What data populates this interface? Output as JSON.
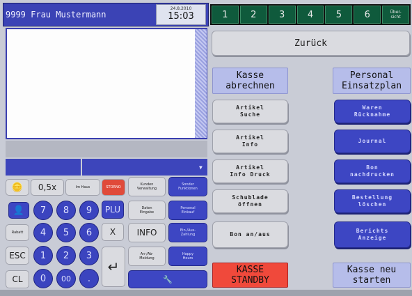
{
  "header": {
    "user": "9999 Frau Mustermann",
    "date": "24.8.2010",
    "time": "15:03"
  },
  "tabs": [
    "1",
    "2",
    "3",
    "4",
    "5",
    "6",
    "Über-\nsicht"
  ],
  "right": {
    "zurueck": "Zurück",
    "kasse_abrechnen": "Kasse\nabrechnen",
    "personal_einsatzplan": "Personal\nEinsatzplan",
    "artikel_suche": "Artikel\nSuche",
    "artikel_info": "Artikel\nInfo",
    "artikel_info_druck": "Artikel\nInfo Druck",
    "schublade_oeffnen": "Schublade\nöffnen",
    "bon_an_aus": "Bon an/aus",
    "waren_ruecknahme": "Waren\nRücknahme",
    "journal": "Journal",
    "bon_nachdrucken": "Bon\nnachdrucken",
    "bestellung_loeschen": "Bestellung\nlöschen",
    "berichts_anzeige": "Berichts\nAnzeige",
    "kasse_standby": "KASSE\nSTANDBY",
    "kasse_neu_starten": "Kasse neu\nstarten"
  },
  "keypad": {
    "half": "0,5x",
    "im_haus": "Im Haus",
    "storno": "STORNO",
    "kunden": "Kunden\nVerwaltung",
    "sonder": "Sonder\nFunktionen",
    "plu": "PLU",
    "daten": "Daten\nEingabe",
    "personal_einkauf": "Personal\nEinkauf",
    "rabatt": "Rabatt",
    "x": "X",
    "info": "INFO",
    "ein_aus": "Ein-/Aus-\nZahlung",
    "esc": "ESC",
    "an_ab": "An-/Ab-\nMeldung",
    "happy": "Happy\nHours",
    "cl": "CL",
    "enter": "↵",
    "digits": [
      "7",
      "8",
      "9",
      "4",
      "5",
      "6",
      "1",
      "2",
      "3",
      "0",
      "00",
      "."
    ]
  },
  "colors": {
    "accent_blue": "#3d46c3",
    "tab_green": "#0f5a3c",
    "standby_red": "#f0493b"
  }
}
